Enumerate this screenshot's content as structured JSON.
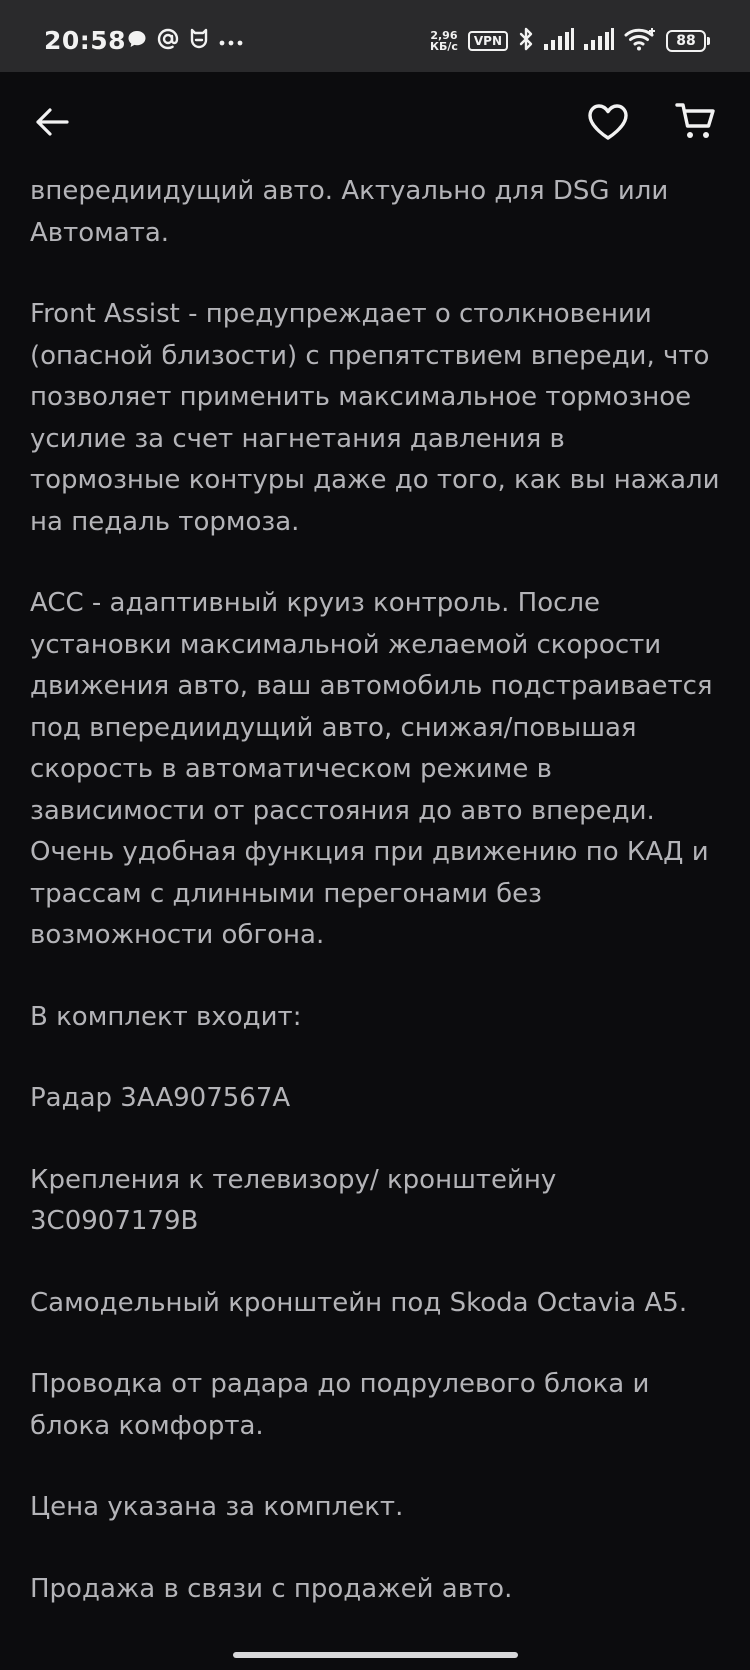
{
  "status_bar": {
    "time": "20:58",
    "notif_icons": [
      "chat-bubble-icon",
      "at-sign-icon",
      "mi-app-icon",
      "more-dots-icon"
    ],
    "net_speed_value": "2,96",
    "net_speed_unit": "КБ/с",
    "vpn_label": "VPN",
    "battery_level": "88"
  },
  "toolbar": {
    "icons": [
      "back-arrow-icon",
      "heart-icon",
      "cart-icon"
    ]
  },
  "description": {
    "paragraphs": [
      "впередиидущий авто. Актуально для DSG или Автомата.",
      "Front Assist - предупреждает о столкновении (опасной близости) с препятствием впереди, что позволяет применить максимальное тормозное усилие за счет нагнетания давления в тормозные контуры даже до того, как вы нажали на педаль тормоза.",
      "ACC - адаптивный круиз контроль. После установки максимальной желаемой скорости движения авто, ваш автомобиль подстраивается под впередиидущий авто, снижая/повышая скорость в автоматическом режиме в зависимости от расстояния до авто впереди. Очень удобная функция при движению по КАД и трассам с длинными перегонами без возможности обгона.",
      "В комплект входит:",
      "Радар 3AA907567A",
      "Крепления к телевизору/ кронштейну 3C0907179B",
      "Самодельный кронштейн под Skoda Octavia A5.",
      "Проводка от радара до подрулевого блока и блока комфорта.",
      "Цена указана за комплект.",
      "Продажа в связи с продажей авто."
    ]
  },
  "colors": {
    "background": "#0c0c0e",
    "status_bar": "#2a2a2c",
    "text": "#b4b4b8",
    "icon": "#f2f2f2"
  }
}
